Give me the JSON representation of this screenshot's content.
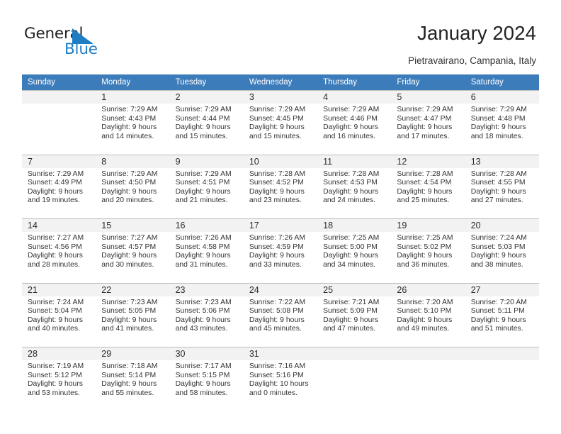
{
  "brand": {
    "name_part1": "General",
    "name_part2": "Blue",
    "triangle_icon": "triangle-icon",
    "accent_color": "#1f7dc4"
  },
  "header": {
    "title": "January 2024",
    "subtitle": "Pietravairano, Campania, Italy"
  },
  "calendar": {
    "header_bg": "#3c7cba",
    "daynum_bg": "#f2f2f2",
    "weekdays": [
      "Sunday",
      "Monday",
      "Tuesday",
      "Wednesday",
      "Thursday",
      "Friday",
      "Saturday"
    ],
    "weeks": [
      [
        {
          "day": "",
          "sunrise": "",
          "sunset": "",
          "daylight1": "",
          "daylight2": ""
        },
        {
          "day": "1",
          "sunrise": "Sunrise: 7:29 AM",
          "sunset": "Sunset: 4:43 PM",
          "daylight1": "Daylight: 9 hours",
          "daylight2": "and 14 minutes."
        },
        {
          "day": "2",
          "sunrise": "Sunrise: 7:29 AM",
          "sunset": "Sunset: 4:44 PM",
          "daylight1": "Daylight: 9 hours",
          "daylight2": "and 15 minutes."
        },
        {
          "day": "3",
          "sunrise": "Sunrise: 7:29 AM",
          "sunset": "Sunset: 4:45 PM",
          "daylight1": "Daylight: 9 hours",
          "daylight2": "and 15 minutes."
        },
        {
          "day": "4",
          "sunrise": "Sunrise: 7:29 AM",
          "sunset": "Sunset: 4:46 PM",
          "daylight1": "Daylight: 9 hours",
          "daylight2": "and 16 minutes."
        },
        {
          "day": "5",
          "sunrise": "Sunrise: 7:29 AM",
          "sunset": "Sunset: 4:47 PM",
          "daylight1": "Daylight: 9 hours",
          "daylight2": "and 17 minutes."
        },
        {
          "day": "6",
          "sunrise": "Sunrise: 7:29 AM",
          "sunset": "Sunset: 4:48 PM",
          "daylight1": "Daylight: 9 hours",
          "daylight2": "and 18 minutes."
        }
      ],
      [
        {
          "day": "7",
          "sunrise": "Sunrise: 7:29 AM",
          "sunset": "Sunset: 4:49 PM",
          "daylight1": "Daylight: 9 hours",
          "daylight2": "and 19 minutes."
        },
        {
          "day": "8",
          "sunrise": "Sunrise: 7:29 AM",
          "sunset": "Sunset: 4:50 PM",
          "daylight1": "Daylight: 9 hours",
          "daylight2": "and 20 minutes."
        },
        {
          "day": "9",
          "sunrise": "Sunrise: 7:29 AM",
          "sunset": "Sunset: 4:51 PM",
          "daylight1": "Daylight: 9 hours",
          "daylight2": "and 21 minutes."
        },
        {
          "day": "10",
          "sunrise": "Sunrise: 7:28 AM",
          "sunset": "Sunset: 4:52 PM",
          "daylight1": "Daylight: 9 hours",
          "daylight2": "and 23 minutes."
        },
        {
          "day": "11",
          "sunrise": "Sunrise: 7:28 AM",
          "sunset": "Sunset: 4:53 PM",
          "daylight1": "Daylight: 9 hours",
          "daylight2": "and 24 minutes."
        },
        {
          "day": "12",
          "sunrise": "Sunrise: 7:28 AM",
          "sunset": "Sunset: 4:54 PM",
          "daylight1": "Daylight: 9 hours",
          "daylight2": "and 25 minutes."
        },
        {
          "day": "13",
          "sunrise": "Sunrise: 7:28 AM",
          "sunset": "Sunset: 4:55 PM",
          "daylight1": "Daylight: 9 hours",
          "daylight2": "and 27 minutes."
        }
      ],
      [
        {
          "day": "14",
          "sunrise": "Sunrise: 7:27 AM",
          "sunset": "Sunset: 4:56 PM",
          "daylight1": "Daylight: 9 hours",
          "daylight2": "and 28 minutes."
        },
        {
          "day": "15",
          "sunrise": "Sunrise: 7:27 AM",
          "sunset": "Sunset: 4:57 PM",
          "daylight1": "Daylight: 9 hours",
          "daylight2": "and 30 minutes."
        },
        {
          "day": "16",
          "sunrise": "Sunrise: 7:26 AM",
          "sunset": "Sunset: 4:58 PM",
          "daylight1": "Daylight: 9 hours",
          "daylight2": "and 31 minutes."
        },
        {
          "day": "17",
          "sunrise": "Sunrise: 7:26 AM",
          "sunset": "Sunset: 4:59 PM",
          "daylight1": "Daylight: 9 hours",
          "daylight2": "and 33 minutes."
        },
        {
          "day": "18",
          "sunrise": "Sunrise: 7:25 AM",
          "sunset": "Sunset: 5:00 PM",
          "daylight1": "Daylight: 9 hours",
          "daylight2": "and 34 minutes."
        },
        {
          "day": "19",
          "sunrise": "Sunrise: 7:25 AM",
          "sunset": "Sunset: 5:02 PM",
          "daylight1": "Daylight: 9 hours",
          "daylight2": "and 36 minutes."
        },
        {
          "day": "20",
          "sunrise": "Sunrise: 7:24 AM",
          "sunset": "Sunset: 5:03 PM",
          "daylight1": "Daylight: 9 hours",
          "daylight2": "and 38 minutes."
        }
      ],
      [
        {
          "day": "21",
          "sunrise": "Sunrise: 7:24 AM",
          "sunset": "Sunset: 5:04 PM",
          "daylight1": "Daylight: 9 hours",
          "daylight2": "and 40 minutes."
        },
        {
          "day": "22",
          "sunrise": "Sunrise: 7:23 AM",
          "sunset": "Sunset: 5:05 PM",
          "daylight1": "Daylight: 9 hours",
          "daylight2": "and 41 minutes."
        },
        {
          "day": "23",
          "sunrise": "Sunrise: 7:23 AM",
          "sunset": "Sunset: 5:06 PM",
          "daylight1": "Daylight: 9 hours",
          "daylight2": "and 43 minutes."
        },
        {
          "day": "24",
          "sunrise": "Sunrise: 7:22 AM",
          "sunset": "Sunset: 5:08 PM",
          "daylight1": "Daylight: 9 hours",
          "daylight2": "and 45 minutes."
        },
        {
          "day": "25",
          "sunrise": "Sunrise: 7:21 AM",
          "sunset": "Sunset: 5:09 PM",
          "daylight1": "Daylight: 9 hours",
          "daylight2": "and 47 minutes."
        },
        {
          "day": "26",
          "sunrise": "Sunrise: 7:20 AM",
          "sunset": "Sunset: 5:10 PM",
          "daylight1": "Daylight: 9 hours",
          "daylight2": "and 49 minutes."
        },
        {
          "day": "27",
          "sunrise": "Sunrise: 7:20 AM",
          "sunset": "Sunset: 5:11 PM",
          "daylight1": "Daylight: 9 hours",
          "daylight2": "and 51 minutes."
        }
      ],
      [
        {
          "day": "28",
          "sunrise": "Sunrise: 7:19 AM",
          "sunset": "Sunset: 5:12 PM",
          "daylight1": "Daylight: 9 hours",
          "daylight2": "and 53 minutes."
        },
        {
          "day": "29",
          "sunrise": "Sunrise: 7:18 AM",
          "sunset": "Sunset: 5:14 PM",
          "daylight1": "Daylight: 9 hours",
          "daylight2": "and 55 minutes."
        },
        {
          "day": "30",
          "sunrise": "Sunrise: 7:17 AM",
          "sunset": "Sunset: 5:15 PM",
          "daylight1": "Daylight: 9 hours",
          "daylight2": "and 58 minutes."
        },
        {
          "day": "31",
          "sunrise": "Sunrise: 7:16 AM",
          "sunset": "Sunset: 5:16 PM",
          "daylight1": "Daylight: 10 hours",
          "daylight2": "and 0 minutes."
        },
        {
          "day": "",
          "sunrise": "",
          "sunset": "",
          "daylight1": "",
          "daylight2": ""
        },
        {
          "day": "",
          "sunrise": "",
          "sunset": "",
          "daylight1": "",
          "daylight2": ""
        },
        {
          "day": "",
          "sunrise": "",
          "sunset": "",
          "daylight1": "",
          "daylight2": ""
        }
      ]
    ]
  }
}
